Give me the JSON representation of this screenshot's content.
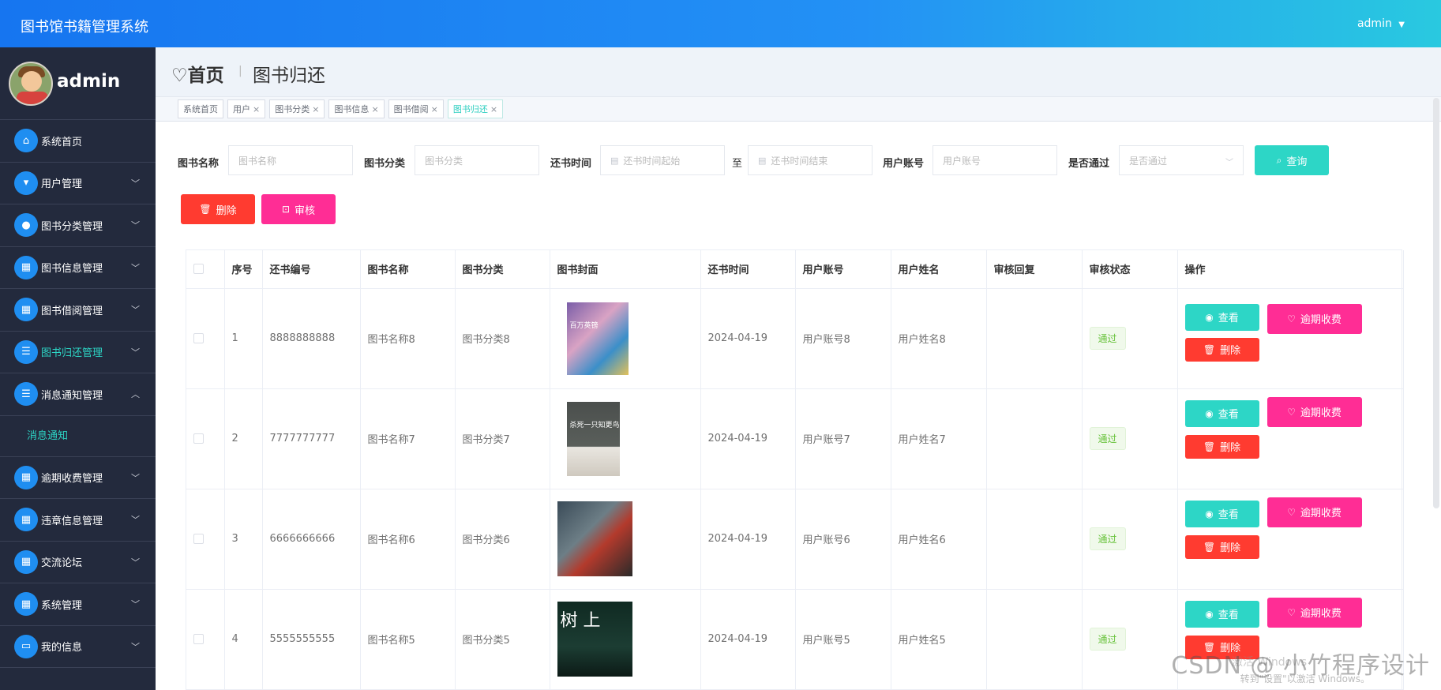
{
  "app": {
    "title": "图书馆书籍管理系统",
    "user": "admin",
    "user_caret": "▼"
  },
  "profile": {
    "name": "admin"
  },
  "menu": [
    {
      "label": "系统首页",
      "icon": "home-icon",
      "chevron": ""
    },
    {
      "label": "用户管理",
      "icon": "user-icon",
      "chevron": "﹀"
    },
    {
      "label": "图书分类管理",
      "icon": "person-icon",
      "chevron": "﹀"
    },
    {
      "label": "图书信息管理",
      "icon": "grid-icon",
      "chevron": "﹀"
    },
    {
      "label": "图书借阅管理",
      "icon": "grid-icon",
      "chevron": "﹀"
    },
    {
      "label": "图书归还管理",
      "icon": "list-icon",
      "chevron": "﹀"
    },
    {
      "label": "消息通知管理",
      "icon": "list-icon",
      "chevron": "︿"
    },
    {
      "label": "逾期收费管理",
      "icon": "grid-icon",
      "chevron": "﹀"
    },
    {
      "label": "违章信息管理",
      "icon": "grid-icon",
      "chevron": "﹀"
    },
    {
      "label": "交流论坛",
      "icon": "grid-icon",
      "chevron": "﹀"
    },
    {
      "label": "系统管理",
      "icon": "grid-icon",
      "chevron": "﹀"
    },
    {
      "label": "我的信息",
      "icon": "card-icon",
      "chevron": "﹀"
    }
  ],
  "submenu": {
    "label": "消息通知"
  },
  "breadcrumb": {
    "home": "首页",
    "current": "图书归还",
    "separator": "|"
  },
  "tabs": [
    {
      "label": "系统首页",
      "close": ""
    },
    {
      "label": "用户",
      "close": "×"
    },
    {
      "label": "图书分类",
      "close": "×"
    },
    {
      "label": "图书信息",
      "close": "×"
    },
    {
      "label": "图书借阅",
      "close": "×"
    },
    {
      "label": "图书归还",
      "close": "×"
    }
  ],
  "search": {
    "book_name_label": "图书名称",
    "book_name_placeholder": "图书名称",
    "category_label": "图书分类",
    "category_placeholder": "图书分类",
    "return_time_label": "还书时间",
    "start_placeholder": "还书时间起始",
    "to_label": "至",
    "end_placeholder": "还书时间结束",
    "account_label": "用户账号",
    "account_placeholder": "用户账号",
    "passed_label": "是否通过",
    "passed_placeholder": "是否通过",
    "query_button": "查询"
  },
  "actions": {
    "delete_button": "删除",
    "review_button": "审核"
  },
  "table": {
    "headers": [
      "序号",
      "还书编号",
      "图书名称",
      "图书分类",
      "图书封面",
      "还书时间",
      "用户账号",
      "用户姓名",
      "审核回复",
      "审核状态",
      "操作"
    ],
    "rows": [
      {
        "no": "1",
        "code": "8888888888",
        "name": "图书名称8",
        "category": "图书分类8",
        "time": "2024-04-19",
        "account": "用户账号8",
        "user": "用户姓名8",
        "reply": "",
        "status": "通过"
      },
      {
        "no": "2",
        "code": "7777777777",
        "name": "图书名称7",
        "category": "图书分类7",
        "time": "2024-04-19",
        "account": "用户账号7",
        "user": "用户姓名7",
        "reply": "",
        "status": "通过"
      },
      {
        "no": "3",
        "code": "6666666666",
        "name": "图书名称6",
        "category": "图书分类6",
        "time": "2024-04-19",
        "account": "用户账号6",
        "user": "用户姓名6",
        "reply": "",
        "status": "通过"
      },
      {
        "no": "4",
        "code": "5555555555",
        "name": "图书名称5",
        "category": "图书分类5",
        "time": "2024-04-19",
        "account": "用户账号5",
        "user": "用户姓名5",
        "reply": "",
        "status": "通过"
      }
    ],
    "row_buttons": {
      "view": "查看",
      "overdue": "逾期收费",
      "delete": "删除"
    }
  },
  "covers": [
    {
      "title": "百万英镑"
    },
    {
      "title": "杀死一只知更鸟"
    },
    {
      "title": ""
    },
    {
      "title": "树 上"
    }
  ],
  "watermark": {
    "csdn": "CSDN @ 小竹程序设计",
    "windows_line1": "激活 Windows",
    "windows_line2": "转到\"设置\"以激活 Windows。"
  },
  "colors": {
    "accent": "#2dd6c6",
    "danger": "#ff3b30",
    "pink": "#ff2d95",
    "nav": "#232a3d",
    "topbar": "#1675f0"
  }
}
